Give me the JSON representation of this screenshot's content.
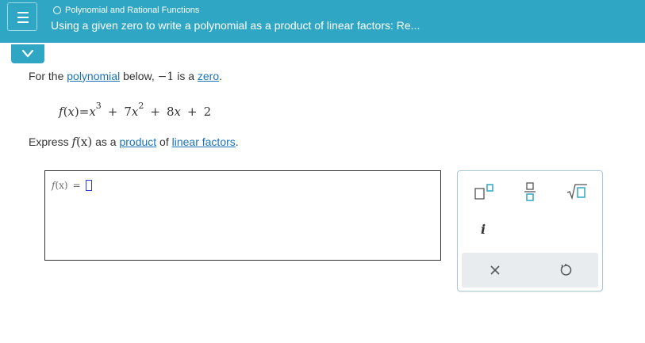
{
  "header": {
    "topic": "Polynomial and Rational Functions",
    "title": "Using a given zero to write a polynomial as a product of linear factors: Re..."
  },
  "prompt": {
    "part1": "For the ",
    "link_polynomial": "polynomial",
    "part2": " below, ",
    "zero_value": "−1",
    "part3": " is a ",
    "link_zero": "zero",
    "part4": "."
  },
  "equation": {
    "lhs_f": "f",
    "lhs_paren_open": "(",
    "lhs_x": "x",
    "lhs_paren_close": ")",
    "equals": "=",
    "t1_base": "x",
    "t1_exp": "3",
    "plus1": "+",
    "t2_coef": "7",
    "t2_base": "x",
    "t2_exp": "2",
    "plus2": "+",
    "t3_coef": "8",
    "t3_base": "x",
    "plus3": "+",
    "t4": "2"
  },
  "express": {
    "word": "Express ",
    "f": "f",
    "arg": "(x)",
    "as_a": " as a ",
    "link_product": "product",
    "of": " of ",
    "link_linear_factors": "linear factors",
    "period": "."
  },
  "answer": {
    "f": "f",
    "arg": "(x)",
    "equals": "="
  },
  "palette": {
    "imaginary_label": "i",
    "accent_color": "#2fa7c4",
    "icons": [
      "superscript-icon",
      "fraction-icon",
      "sqrt-icon",
      "imaginary-i-icon",
      "clear-icon",
      "undo-icon"
    ]
  },
  "colors": {
    "header_bg": "#2fa7c4",
    "link": "#1a73b8",
    "cursor": "#2d3fcf"
  }
}
